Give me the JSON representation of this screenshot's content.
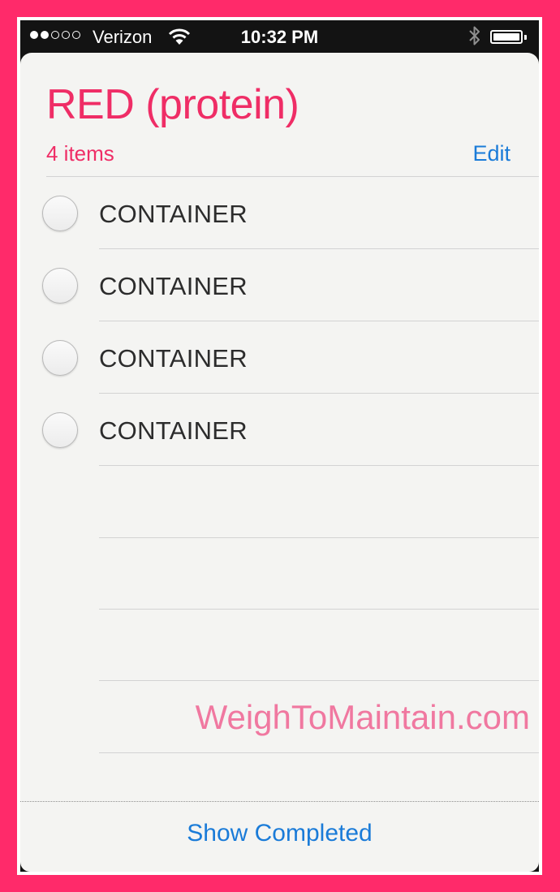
{
  "status_bar": {
    "signal": "●●○○○",
    "carrier": "Verizon",
    "time": "10:32 PM",
    "icons": [
      "wifi-icon",
      "bluetooth-icon",
      "battery-icon"
    ]
  },
  "list": {
    "title": "RED (protein)",
    "count": "4 items",
    "edit_label": "Edit",
    "items": [
      {
        "label": "CONTAINER",
        "completed": false
      },
      {
        "label": "CONTAINER",
        "completed": false
      },
      {
        "label": "CONTAINER",
        "completed": false
      },
      {
        "label": "CONTAINER",
        "completed": false
      }
    ]
  },
  "watermark": "WeighToMaintain.com",
  "footer": {
    "show_completed_label": "Show Completed"
  },
  "colors": {
    "frame": "#ff2a6a",
    "title": "#ef2d66",
    "link": "#1a7bd8",
    "watermark": "#f078a0",
    "paper": "#f4f4f2"
  }
}
